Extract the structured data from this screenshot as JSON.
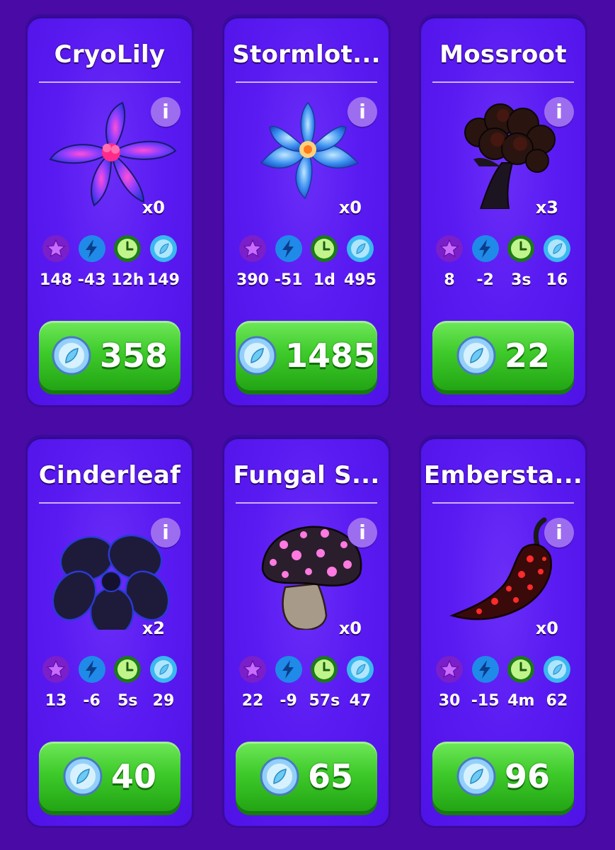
{
  "cards": [
    {
      "title": "CryoLily",
      "count": "x0",
      "stats": [
        "148",
        "-43",
        "12h",
        "149"
      ],
      "price": "358",
      "item_icon": "cryo-lily-icon"
    },
    {
      "title": "Stormlot...",
      "count": "x0",
      "stats": [
        "390",
        "-51",
        "1d",
        "495"
      ],
      "price": "1485",
      "item_icon": "storm-lotus-icon"
    },
    {
      "title": "Mossroot",
      "count": "x3",
      "stats": [
        "8",
        "-2",
        "3s",
        "16"
      ],
      "price": "22",
      "item_icon": "mossroot-icon"
    },
    {
      "title": "Cinderleaf",
      "count": "x2",
      "stats": [
        "13",
        "-6",
        "5s",
        "29"
      ],
      "price": "40",
      "item_icon": "cinderleaf-icon"
    },
    {
      "title": "Fungal S...",
      "count": "x0",
      "stats": [
        "22",
        "-9",
        "57s",
        "47"
      ],
      "price": "65",
      "item_icon": "fungal-mushroom-icon"
    },
    {
      "title": "Embersta...",
      "count": "x0",
      "stats": [
        "30",
        "-15",
        "4m",
        "62"
      ],
      "price": "96",
      "item_icon": "ember-pepper-icon"
    }
  ],
  "info_label": "i",
  "stat_icons": [
    "star-icon",
    "lightning-icon",
    "clock-icon",
    "leaf-coin-icon"
  ],
  "colors": {
    "background": "#4a0aa6",
    "card": "#5a1bf2",
    "buy_button": "#3fcb2b",
    "info_button": "#9d6df0"
  }
}
